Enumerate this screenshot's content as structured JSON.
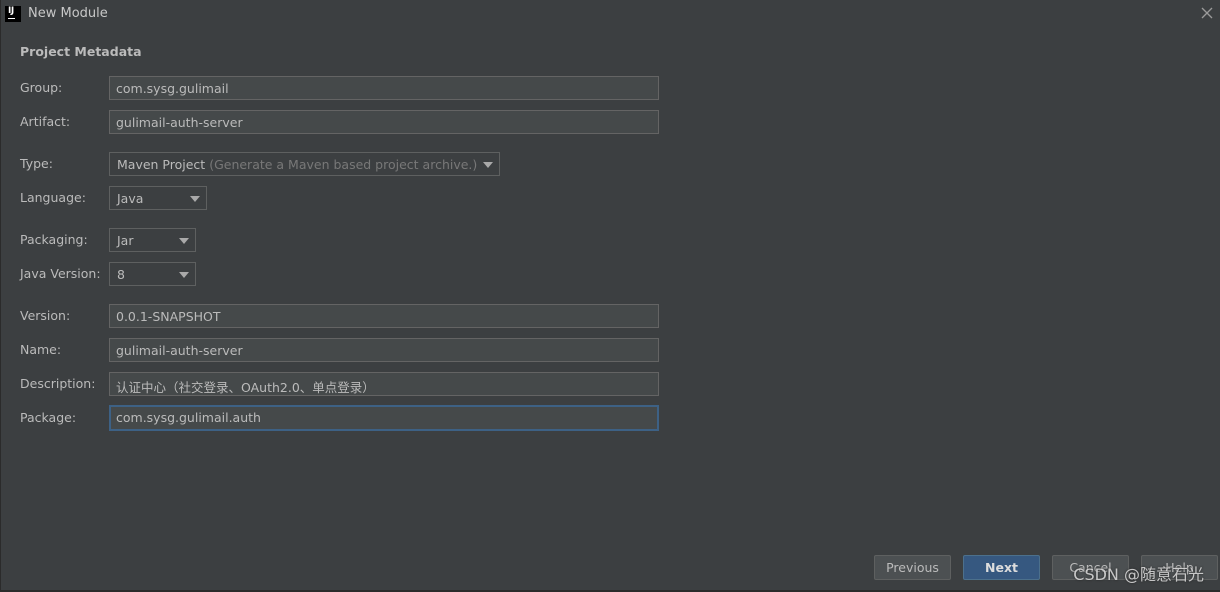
{
  "window": {
    "title": "New Module",
    "app_icon_text": "IJ"
  },
  "section_title": "Project Metadata",
  "fields": {
    "group": {
      "label": "Group:",
      "value": "com.sysg.gulimail"
    },
    "artifact": {
      "label": "Artifact:",
      "value": "gulimail-auth-server"
    },
    "type": {
      "label": "Type:",
      "value": "Maven Project",
      "hint": "(Generate a Maven based project archive.)"
    },
    "language": {
      "label": "Language:",
      "value": "Java"
    },
    "packaging": {
      "label": "Packaging:",
      "value": "Jar"
    },
    "java_version": {
      "label": "Java Version:",
      "value": "8"
    },
    "version": {
      "label": "Version:",
      "value": "0.0.1-SNAPSHOT"
    },
    "name": {
      "label": "Name:",
      "value": "gulimail-auth-server"
    },
    "description": {
      "label": "Description:",
      "value": "认证中心（社交登录、OAuth2.0、单点登录）"
    },
    "package": {
      "label": "Package:",
      "value": "com.sysg.gulimail.auth"
    }
  },
  "buttons": {
    "previous": "Previous",
    "next": "Next",
    "cancel": "Cancel",
    "help": "Help"
  },
  "watermark": "CSDN @随意石光",
  "colors": {
    "background": "#3c3f41",
    "field_background": "#45494a",
    "primary_button": "#365880",
    "focus_border": "#3d6185"
  }
}
